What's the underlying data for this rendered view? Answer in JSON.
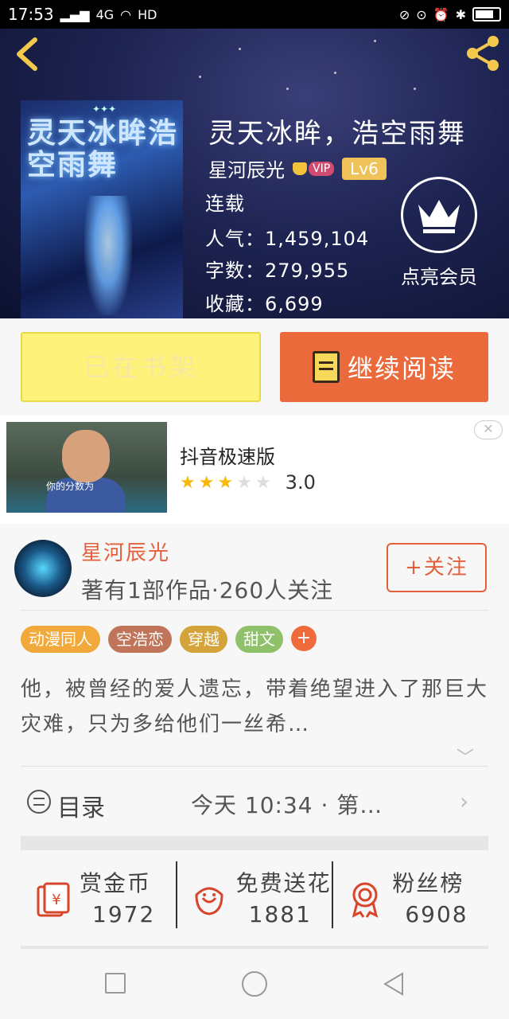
{
  "status_bar": {
    "time": "17:53",
    "network": "4G",
    "hd": "HD"
  },
  "book": {
    "title": "灵天冰眸，浩空雨舞",
    "cover_title": "灵天冰眸浩空雨舞",
    "author": "星河辰光",
    "vip": "VIP",
    "level": "Lv6",
    "status": "连载",
    "popularity": "人气：1,459,104",
    "word_count": "字数：279,955",
    "favorites": "收藏：6,699"
  },
  "member": {
    "label": "点亮会员"
  },
  "actions": {
    "shelf_label": "已在书架",
    "read_label": "继续阅读"
  },
  "ad": {
    "title": "抖音极速版",
    "rating": 3.0,
    "rating_text": "3.0",
    "thumb_caption": "你的分数为"
  },
  "author_section": {
    "name": "星河辰光",
    "stats": "著有1部作品·260人关注",
    "follow_label": "+关注"
  },
  "tags": [
    {
      "label": "动漫同人",
      "color": "#f2a93b"
    },
    {
      "label": "空浩恋",
      "color": "#c0745a"
    },
    {
      "label": "穿越",
      "color": "#d4a43a"
    },
    {
      "label": "甜文",
      "color": "#8fc06a"
    }
  ],
  "synopsis": "他，被曾经的爱人遗忘，带着绝望进入了那巨大灾难，只为多给他们一丝希…",
  "catalog": {
    "label": "目录",
    "update": "今天 10:34 · 第…"
  },
  "rewards": [
    {
      "label": "赏金币",
      "value": "1972",
      "icon": "red-envelope-icon"
    },
    {
      "label": "免费送花",
      "value": "1881",
      "icon": "flower-icon"
    },
    {
      "label": "粉丝榜",
      "value": "6908",
      "icon": "medal-icon"
    }
  ],
  "colors": {
    "accent": "#ea6a3c",
    "shelf_button": "#fff27a",
    "author_name": "#e4603c"
  }
}
